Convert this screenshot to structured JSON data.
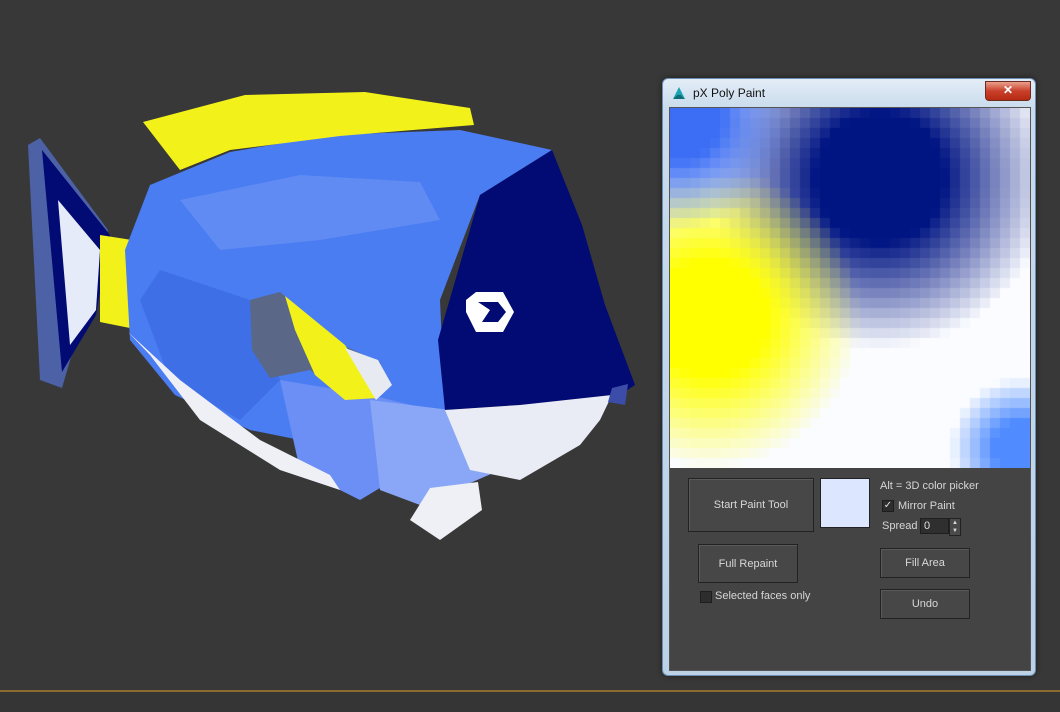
{
  "window": {
    "title": "pX Poly Paint",
    "close_label": "✕",
    "app_icon": "3ds-max-logo-icon"
  },
  "panel": {
    "start_paint_label": "Start Paint Tool",
    "current_color": "#dde6ff",
    "hint_text": "Alt = 3D color picker",
    "mirror_label": "Mirror Paint",
    "mirror_checked": true,
    "spread_label": "Spread",
    "spread_value": "0",
    "full_repaint_label": "Full Repaint",
    "selected_faces_label": "Selected faces only",
    "selected_faces_checked": false,
    "fill_area_label": "Fill Area",
    "undo_label": "Undo"
  },
  "colors": {
    "viewport_bg": "#383838",
    "fish_blue": "#4a7cf2",
    "fish_navy": "#020a73",
    "fish_yellow": "#f2f21a",
    "fish_white": "#eef0f6"
  }
}
